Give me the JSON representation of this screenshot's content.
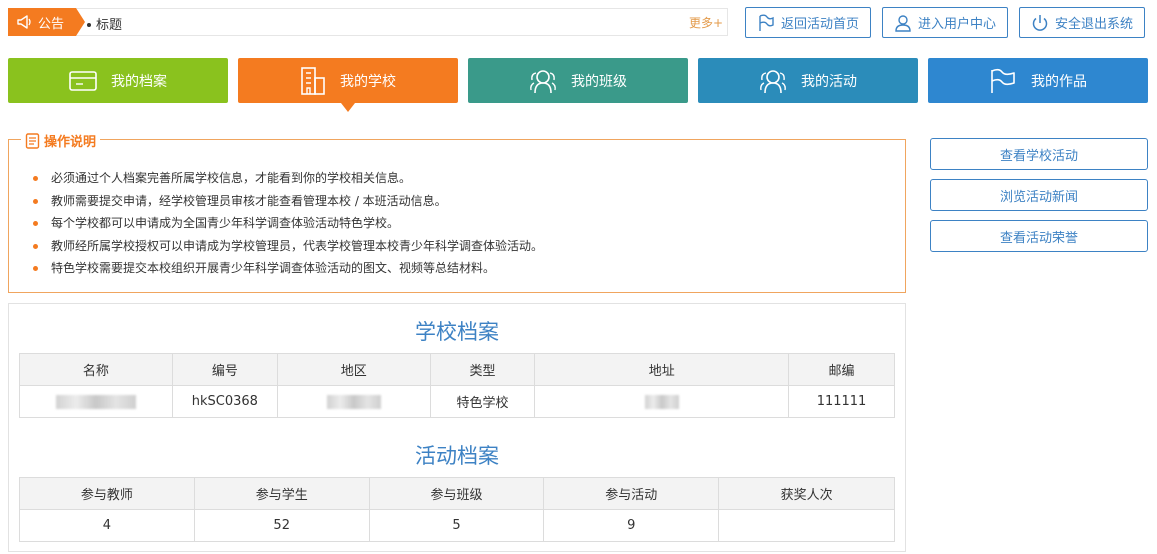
{
  "notice": {
    "tag_label": "公告",
    "title": "标题",
    "more_label": "更多+"
  },
  "top_buttons": [
    {
      "label": "返回活动首页",
      "icon": "flag-icon"
    },
    {
      "label": "进入用户中心",
      "icon": "user-icon"
    },
    {
      "label": "安全退出系统",
      "icon": "power-icon"
    }
  ],
  "nav": [
    {
      "label": "我的档案",
      "icon": "card-icon",
      "color": "#8ac21e"
    },
    {
      "label": "我的学校",
      "icon": "building-icon",
      "color": "#f47b20",
      "active": true
    },
    {
      "label": "我的班级",
      "icon": "group-icon",
      "color": "#3a9a8a"
    },
    {
      "label": "我的活动",
      "icon": "group-icon",
      "color": "#2b8cba"
    },
    {
      "label": "我的作品",
      "icon": "flag-icon",
      "color": "#2e87d0"
    }
  ],
  "instructions": {
    "title": "操作说明",
    "items": [
      "必须通过个人档案完善所属学校信息，才能看到你的学校相关信息。",
      "教师需要提交申请，经学校管理员审核才能查看管理本校 / 本班活动信息。",
      "每个学校都可以申请成为全国青少年科学调查体验活动特色学校。",
      "教师经所属学校授权可以申请成为学校管理员，代表学校管理本校青少年科学调查体验活动。",
      "特色学校需要提交本校组织开展青少年科学调查体验活动的图文、视频等总结材料。"
    ]
  },
  "side_buttons": [
    {
      "label": "查看学校活动"
    },
    {
      "label": "浏览活动新闻"
    },
    {
      "label": "查看活动荣誉"
    }
  ],
  "school_record": {
    "title": "学校档案",
    "columns": [
      "名称",
      "编号",
      "地区",
      "类型",
      "地址",
      "邮编"
    ],
    "row": {
      "name": "",
      "code": "hkSC0368",
      "region": "",
      "type": "特色学校",
      "address": "",
      "postcode": "111111"
    }
  },
  "activity_record": {
    "title": "活动档案",
    "columns": [
      "参与教师",
      "参与学生",
      "参与班级",
      "参与活动",
      "获奖人次"
    ],
    "values": [
      "4",
      "52",
      "5",
      "9",
      ""
    ]
  },
  "colors": {
    "accent_orange": "#f47b20",
    "accent_blue": "#3d82c4"
  }
}
